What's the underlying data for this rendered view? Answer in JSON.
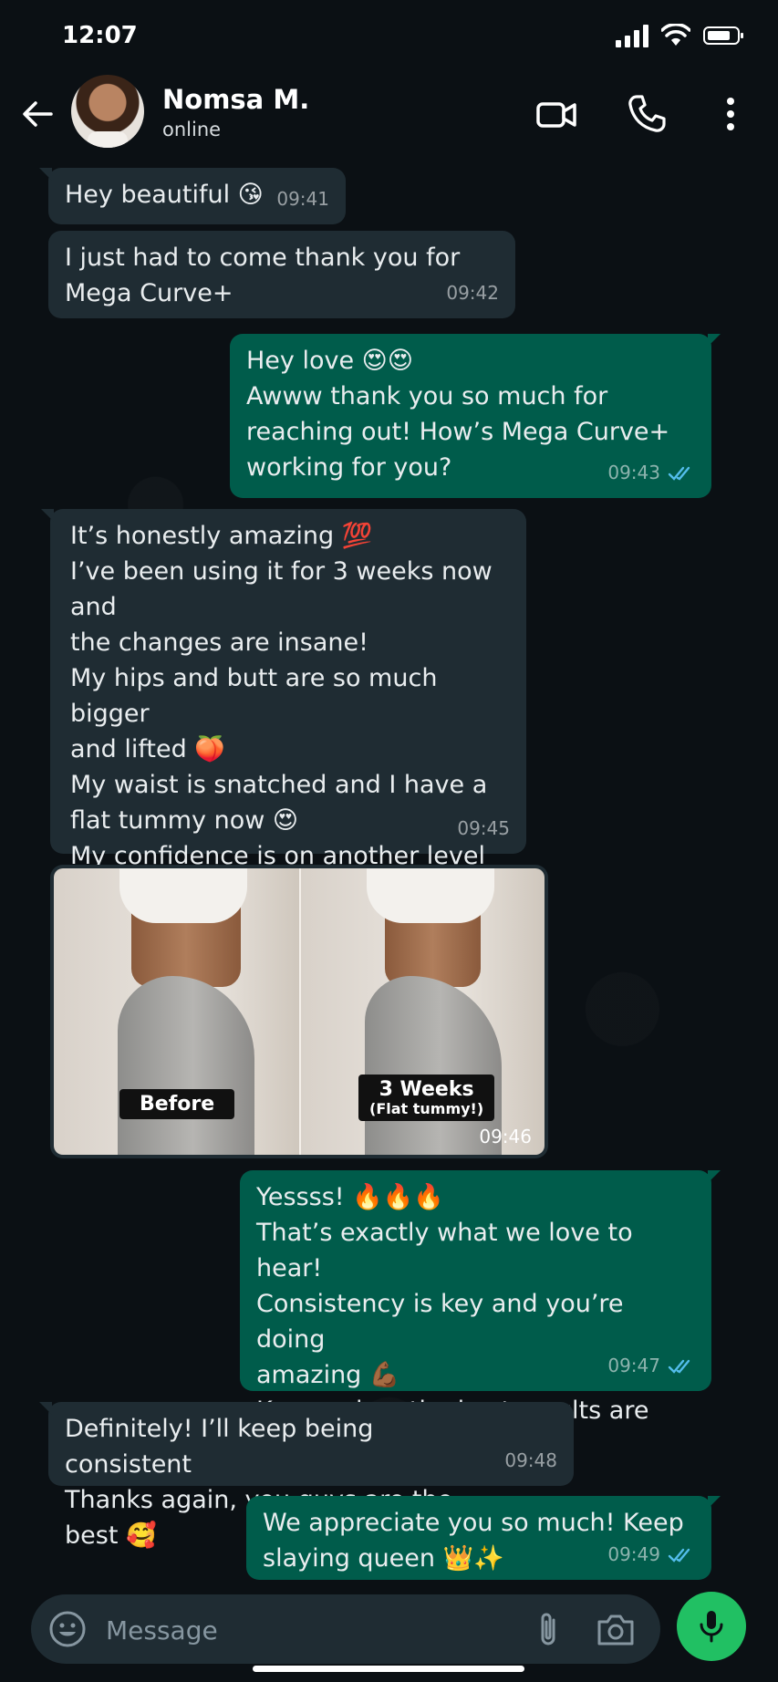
{
  "status_bar": {
    "time": "12:07"
  },
  "header": {
    "contact_name": "Nomsa M.",
    "contact_status": "online"
  },
  "messages": [
    {
      "dir": "in",
      "text": "Hey beautiful 😘",
      "time": "09:41"
    },
    {
      "dir": "in",
      "text": "I just had to come thank you for\nMega Curve+",
      "time": "09:42"
    },
    {
      "dir": "out",
      "text": "Hey love 😍😍\nAwww thank you so much for\nreaching out! How’s Mega Curve+\nworking for you?",
      "time": "09:43"
    },
    {
      "dir": "in",
      "text": "It’s honestly amazing 💯\nI’ve been using it for 3 weeks now and\nthe changes are insane!\nMy hips and butt are so much bigger\nand lifted 🍑\nMy waist is snatched and I have a\nflat tummy now 😍\nMy confidence is on another level 🙌🏾\nThank you so much!",
      "time": "09:45"
    },
    {
      "dir": "out",
      "text": "Yessss! 🔥🔥🔥\nThat’s exactly what we love to hear!\nConsistency is key and you’re doing\namazing 💪🏾\nKeep going, the best results are\nstill coming 😍",
      "time": "09:47"
    },
    {
      "dir": "in",
      "text": "Definitely! I’ll keep being consistent\nThanks again, you guys are the best 🥰",
      "time": "09:48"
    },
    {
      "dir": "out",
      "text": "We appreciate you so much! Keep\nslaying queen 👑✨",
      "time": "09:49"
    }
  ],
  "photo": {
    "before_label": "Before",
    "after_label": "3 Weeks",
    "after_sublabel": "(Flat tummy!)",
    "time": "09:46"
  },
  "composer": {
    "placeholder": "Message"
  },
  "colors": {
    "incoming": "#1f2c33",
    "outgoing": "#005c4b",
    "accent": "#21c063",
    "read_ticks": "#53bdeb"
  },
  "icons": [
    "back-arrow-icon",
    "video-call-icon",
    "phone-icon",
    "more-icon",
    "emoji-icon",
    "attach-icon",
    "camera-icon",
    "mic-icon",
    "read-ticks-icon"
  ]
}
